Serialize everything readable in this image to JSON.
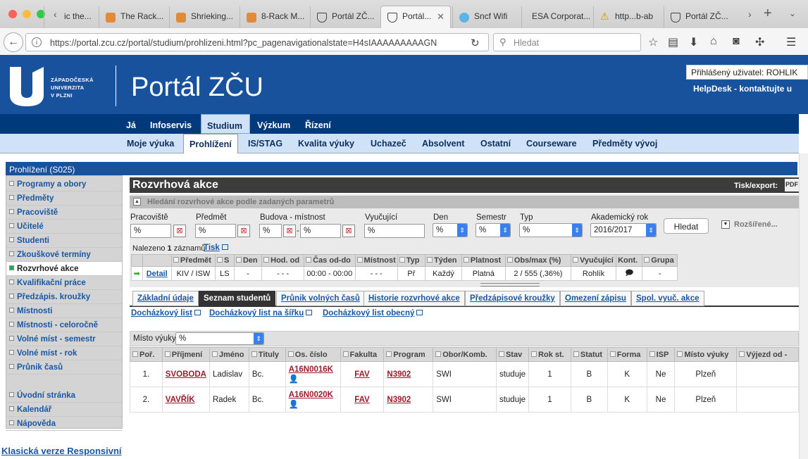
{
  "browser": {
    "tabs": [
      {
        "label": "ic the..."
      },
      {
        "label": "The Rack..."
      },
      {
        "label": "Shrieking..."
      },
      {
        "label": "8-Rack M..."
      },
      {
        "label": "Portál ZČ..."
      },
      {
        "label": "Portál..."
      },
      {
        "label": "Sncf Wifi"
      },
      {
        "label": "ESA Corporat..."
      },
      {
        "label": "http...b-ab"
      },
      {
        "label": "Portál ZČ..."
      }
    ],
    "url": "https://portal.zcu.cz/portal/studium/prohlizeni.html?pc_pagenavigationalstate=H4sIAAAAAAAAAGN",
    "search_placeholder": "Hledat",
    "new_tab": "+",
    "tab_close": "✕"
  },
  "header": {
    "logo_lines": [
      "ZÁPADOČESKÁ",
      "UNIVERZITA",
      "V PLZNI"
    ],
    "title": "Portál ZČU",
    "user_label": "Přihlášený uživatel: ROHLIK",
    "helpdesk": "HelpDesk - kontaktujte u"
  },
  "mainmenu": [
    "Já",
    "Infoservis",
    "Studium",
    "Výzkum",
    "Řízení"
  ],
  "submenu": [
    "Moje výuka",
    "Prohlížení",
    "IS/STAG",
    "Kvalita výuky",
    "Uchazeč",
    "Absolvent",
    "Ostatní",
    "Courseware",
    "Předměty vývoj"
  ],
  "section_title": "Prohlížení (S025)",
  "sidebar": {
    "items": [
      "Programy a obory",
      "Předměty",
      "Pracoviště",
      "Učitelé",
      "Studenti",
      "Zkouškové termíny",
      "Rozvrhové akce",
      "Kvalifikační práce",
      "Předzápis. kroužky",
      "Místnosti",
      "Místnosti - celoročně",
      "Volné míst - semestr",
      "Volné míst - rok",
      "Průnik časů"
    ],
    "bottom": [
      "Úvodní stránka",
      "Kalendář",
      "Nápověda"
    ]
  },
  "panel": {
    "title": "Rozvrhová akce",
    "tisk_export": "Tisk/export:",
    "pdf": "PDF",
    "search_head": "Hledání rozvrhové akce podle zadaných parametrů",
    "labels": {
      "pracoviste": "Pracoviště",
      "predmet": "Předmět",
      "budova": "Budova - místnost",
      "vyucujici": "Vyučující",
      "den": "Den",
      "semestr": "Semestr",
      "typ": "Typ",
      "rok": "Akademický rok"
    },
    "values": {
      "pracoviste": "%",
      "predmet": "%",
      "budova": "%",
      "mistnost": "%",
      "vyucujici": "%",
      "den": "%",
      "semestr": "%",
      "typ": "%",
      "rok": "2016/2017"
    },
    "dash": "-",
    "clear_symbol": "⊠",
    "hledat": "Hledat",
    "rozsirene": "Rozšířené...",
    "nalezeno_prefix": "Nalezeno",
    "nalezeno_count": "1",
    "nalezeno_suffix": "záznamů",
    "tisk": "Tisk"
  },
  "results": {
    "headers": [
      "",
      "",
      "Předmět",
      "S",
      "Den",
      "Hod. od",
      "Čas od-do",
      "Místnost",
      "Typ",
      "Týden",
      "Platnost",
      "Obs/max (%)",
      "Vyučující",
      "Kont.",
      "Grupa"
    ],
    "row": {
      "detail": "Detail",
      "predmet": "KIV / ISW",
      "s": "LS",
      "den": "-",
      "hod": "- - -",
      "cas": "00:00 - 00:00",
      "mistnost": "- - -",
      "typ": "Př",
      "tyden": "Každý",
      "platnost": "Platná",
      "obs": "2 / 555 (,36%)",
      "vyucujici": "Rohlík",
      "grupa": "-"
    }
  },
  "tabs2": [
    "Základní údaje",
    "Seznam studentů",
    "Průnik volných časů",
    "Historie rozvrhové akce",
    "Předzápisové kroužky",
    "Omezení zápisu",
    "Spol. vyuč. akce"
  ],
  "doc_links": [
    "Docházkový list",
    "Docházkový list na šířku",
    "Docházkový list obecný"
  ],
  "misto_vyuky_label": "Místo výuky",
  "misto_vyuky_value": "%",
  "students": {
    "headers": [
      "Poř.",
      "Příjmení",
      "Jméno",
      "Tituly",
      "Os. číslo",
      "Fakulta",
      "Program",
      "Obor/Komb.",
      "Stav",
      "Rok st.",
      "Statut",
      "Forma",
      "ISP",
      "Místo výuky",
      "Výjezd od -"
    ],
    "rows": [
      {
        "por": "1.",
        "prijmeni": "SVOBODA",
        "jmeno": "Ladislav",
        "tituly": "Bc.",
        "os": "A16N0016K",
        "fakulta": "FAV",
        "program": "N3902",
        "obor": "SWI",
        "stav": "studuje",
        "rok": "1",
        "statut": "B",
        "forma": "K",
        "isp": "Ne",
        "misto": "Plzeň"
      },
      {
        "por": "2.",
        "prijmeni": "VAVŘÍK",
        "jmeno": "Radek",
        "tituly": "Bc.",
        "os": "A16N0020K",
        "fakulta": "FAV",
        "program": "N3902",
        "obor": "SWI",
        "stav": "studuje",
        "rok": "1",
        "statut": "B",
        "forma": "K",
        "isp": "Ne",
        "misto": "Plzeň"
      }
    ]
  },
  "footer": {
    "klasicka": "Klasická verze",
    "responsivni": "Responsivní"
  }
}
